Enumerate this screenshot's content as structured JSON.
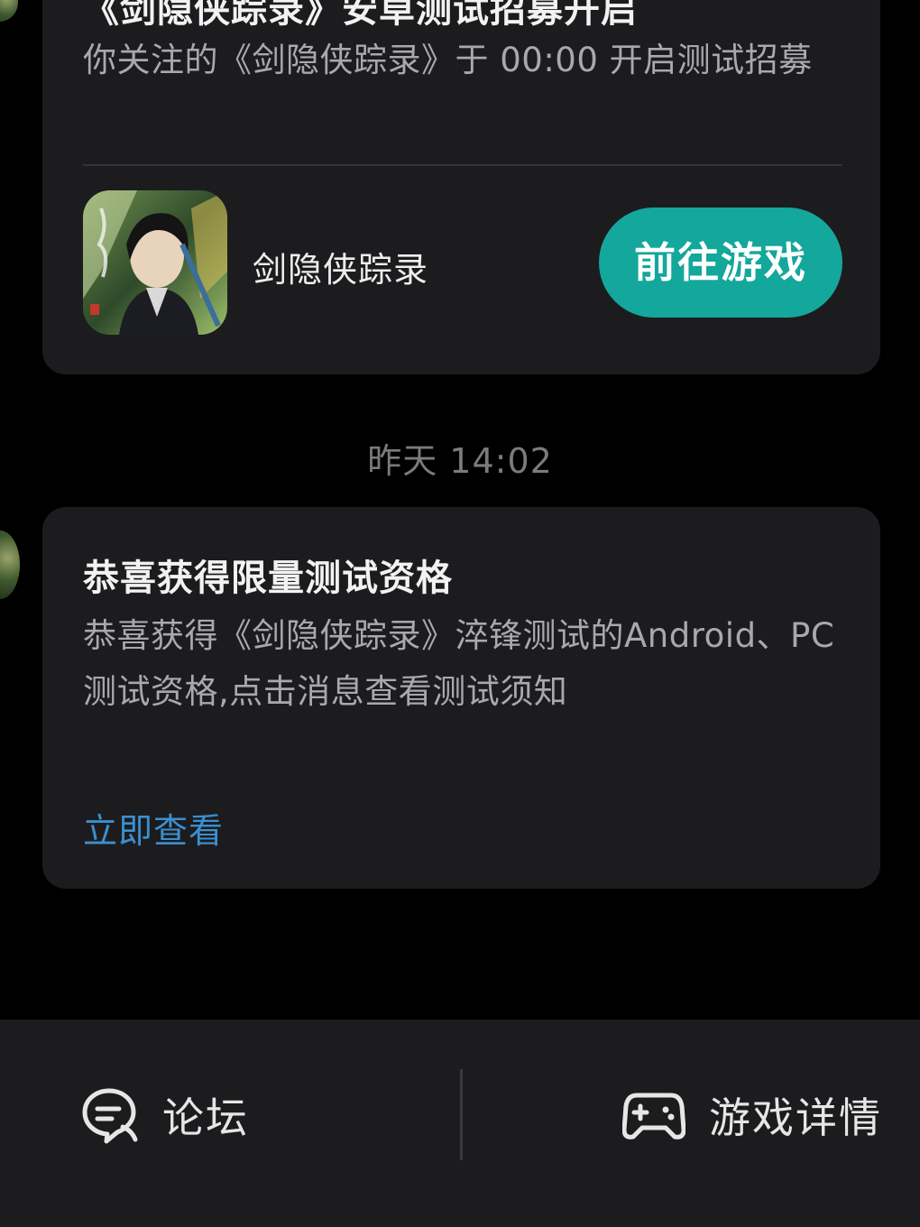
{
  "messages": [
    {
      "title": "《剑隐侠踪录》安卓测试招募开启",
      "body": "你关注的《剑隐侠踪录》于 00:00 开启测试招募",
      "game": {
        "name": "剑隐侠踪录",
        "icon": "game-cover-art"
      },
      "action_label": "前往游戏"
    },
    {
      "timestamp": "昨天  14:02",
      "title": "恭喜获得限量测试资格",
      "body": "恭喜获得《剑隐侠踪录》淬锋测试的Android、PC测试资格,点击消息查看测试须知",
      "link_label": "立即查看"
    }
  ],
  "bottom_bar": {
    "forum_label": "论坛",
    "forum_icon": "chat-bubble-icon",
    "detail_label": "游戏详情",
    "detail_icon": "gamepad-icon"
  },
  "colors": {
    "background": "#000000",
    "card": "#1c1c1e",
    "accent_button": "#14a79c",
    "link": "#3b8fd0"
  }
}
